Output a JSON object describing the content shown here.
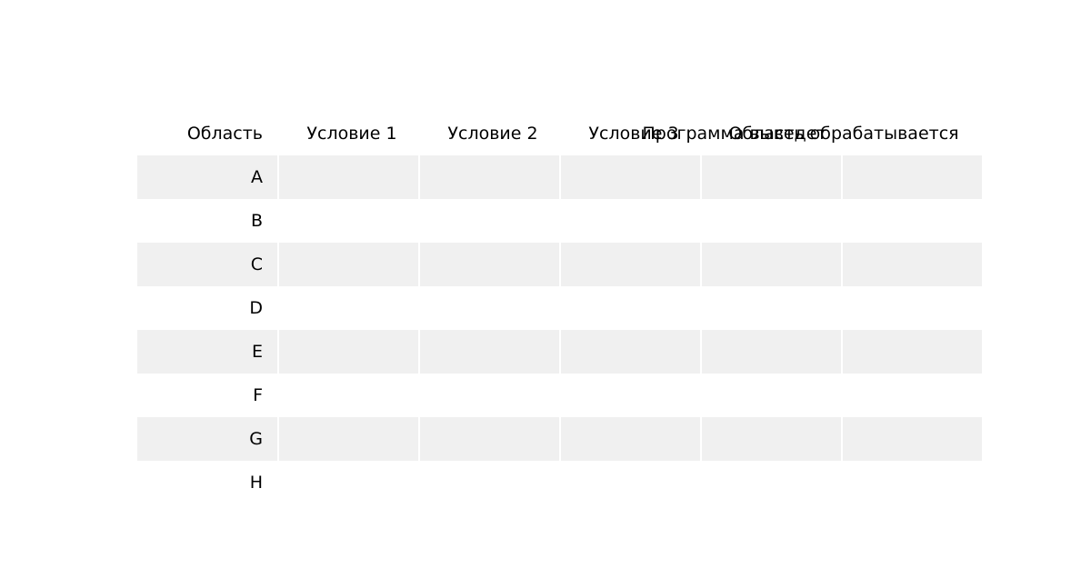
{
  "table": {
    "columns": [
      "Область",
      "Условие 1",
      "Условие 2",
      "Условие 3",
      "Программа выведет",
      "Область обрабатывается"
    ],
    "rows": [
      {
        "label": "A",
        "cells": [
          "",
          "",
          "",
          "",
          ""
        ]
      },
      {
        "label": "B",
        "cells": [
          "",
          "",
          "",
          "",
          ""
        ]
      },
      {
        "label": "C",
        "cells": [
          "",
          "",
          "",
          "",
          ""
        ]
      },
      {
        "label": "D",
        "cells": [
          "",
          "",
          "",
          "",
          ""
        ]
      },
      {
        "label": "E",
        "cells": [
          "",
          "",
          "",
          "",
          ""
        ]
      },
      {
        "label": "F",
        "cells": [
          "",
          "",
          "",
          "",
          ""
        ]
      },
      {
        "label": "G",
        "cells": [
          "",
          "",
          "",
          "",
          ""
        ]
      },
      {
        "label": "H",
        "cells": [
          "",
          "",
          "",
          "",
          ""
        ]
      }
    ],
    "shade_color": "#f0f0f0"
  }
}
